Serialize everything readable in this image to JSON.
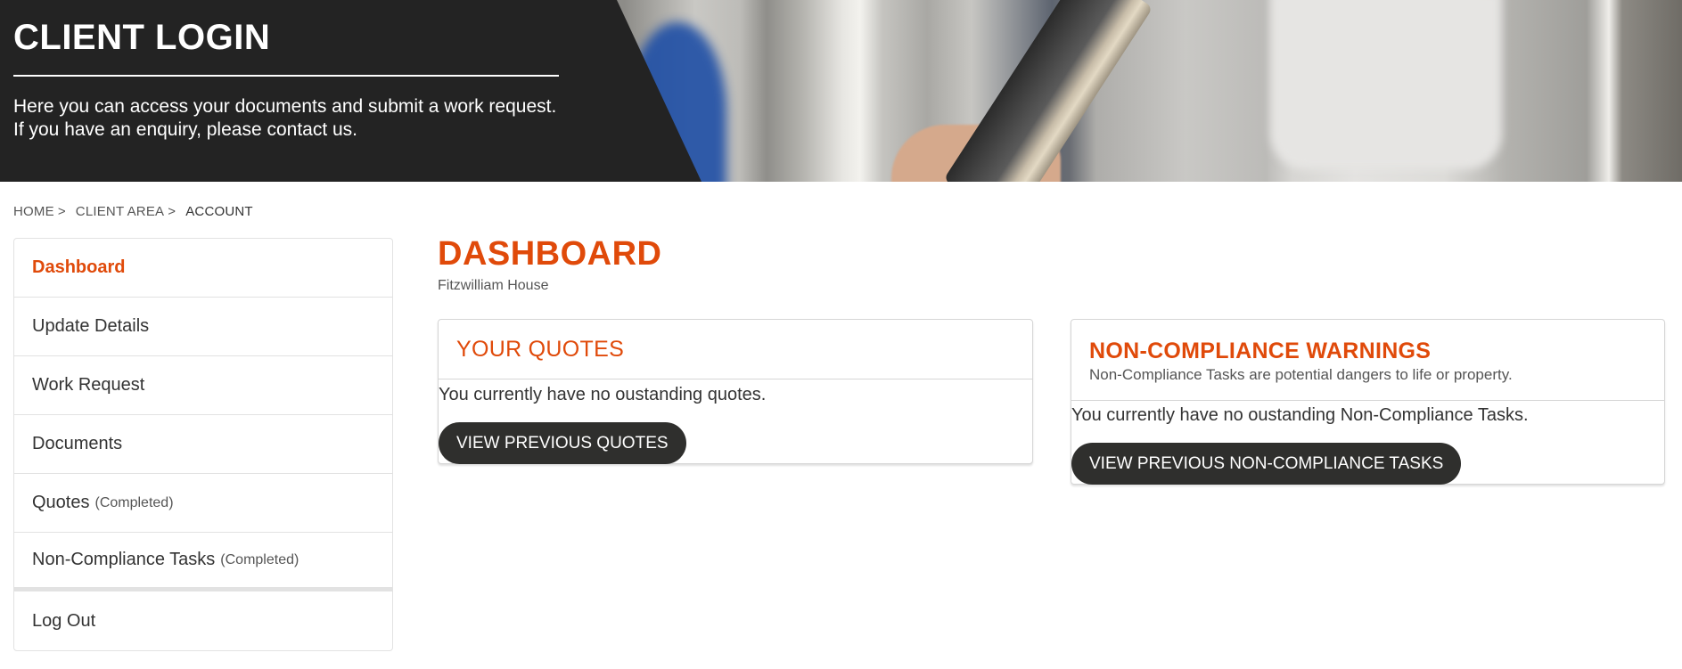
{
  "hero": {
    "title": "CLIENT LOGIN",
    "description": "Here you can access your documents and submit a work request. If you have an enquiry, please contact us."
  },
  "breadcrumb": {
    "items": [
      {
        "label": "HOME",
        "separator": ">"
      },
      {
        "label": "CLIENT AREA",
        "separator": ">"
      },
      {
        "label": "ACCOUNT",
        "separator": ""
      }
    ]
  },
  "sidebar": {
    "items": [
      {
        "label": "Dashboard",
        "note": "",
        "active": true
      },
      {
        "label": "Update Details",
        "note": ""
      },
      {
        "label": "Work Request",
        "note": ""
      },
      {
        "label": "Documents",
        "note": ""
      },
      {
        "label": "Quotes",
        "note": "(Completed)"
      },
      {
        "label": "Non-Compliance Tasks",
        "note": "(Completed)"
      },
      {
        "label": "Log Out",
        "note": ""
      }
    ]
  },
  "main": {
    "title": "DASHBOARD",
    "subtitle": "Fitzwilliam House",
    "quotes_card": {
      "title": "YOUR QUOTES",
      "message": "You currently have no oustanding quotes.",
      "button_label": "VIEW PREVIOUS QUOTES"
    },
    "nc_card": {
      "title": "NON-COMPLIANCE WARNINGS",
      "subtitle": "Non-Compliance Tasks are potential dangers to life or property.",
      "message": "You currently have no oustanding Non-Compliance Tasks.",
      "button_label": "VIEW PREVIOUS NON-COMPLIANCE TASKS"
    }
  },
  "colors": {
    "accent": "#e04a0a",
    "hero_dark": "#232323",
    "button": "#2f2f2d",
    "border": "#e2e2e2"
  }
}
